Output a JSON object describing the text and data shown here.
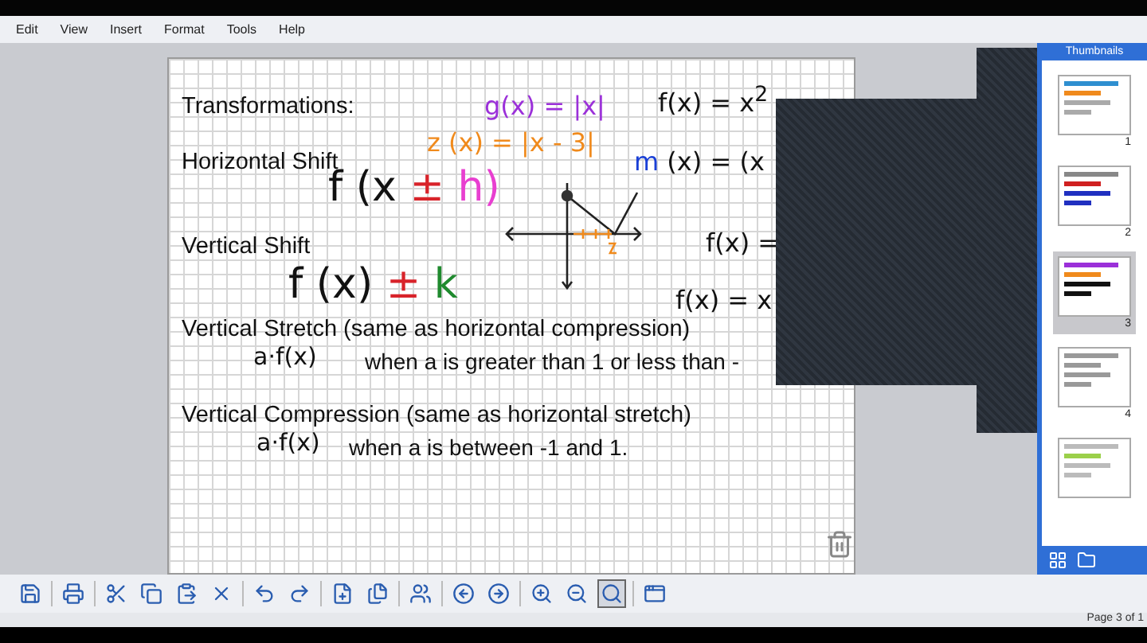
{
  "menu": [
    "Edit",
    "View",
    "Insert",
    "Format",
    "Tools",
    "Help"
  ],
  "canvas": {
    "texts": [
      {
        "kind": "heading",
        "text": "Transformations:"
      },
      {
        "kind": "heading",
        "text": "Horizontal Shift"
      },
      {
        "kind": "heading",
        "text": "Vertical Shift"
      },
      {
        "kind": "heading",
        "text": "Vertical Stretch (same as horizontal compression)"
      },
      {
        "kind": "note",
        "text": "when a is greater than 1 or less than -"
      },
      {
        "kind": "heading",
        "text": "Vertical Compression (same as horizontal stretch)"
      },
      {
        "kind": "note",
        "text": "when a is between -1 and 1."
      }
    ],
    "formulas": [
      {
        "parts": [
          {
            "text": "f (x ",
            "color": "#111111"
          },
          {
            "text": "±",
            "color": "#d8232a"
          },
          {
            "text": " h)",
            "color": "#e83fd0"
          }
        ]
      },
      {
        "parts": [
          {
            "text": "f (x) ",
            "color": "#111111"
          },
          {
            "text": "±",
            "color": "#d8232a"
          },
          {
            "text": " k",
            "color": "#1f8a2e"
          }
        ]
      },
      {
        "parts": [
          {
            "text": "a·f(x)",
            "color": "#111111"
          }
        ]
      },
      {
        "parts": [
          {
            "text": "a·f(x)",
            "color": "#111111"
          }
        ]
      },
      {
        "parts": [
          {
            "text": "g(x) = |x|",
            "color": "#9b30d9"
          }
        ]
      },
      {
        "parts": [
          {
            "text": "z (x) = |x - 3|",
            "color": "#f08a1c"
          }
        ]
      },
      {
        "parts": [
          {
            "text": "f(x) = x$^{2}$",
            "color": "#111111"
          }
        ]
      },
      {
        "parts": [
          {
            "text": "m",
            "color": "#1a3fd6"
          },
          {
            "text": " (x) = (x",
            "color": "#111111"
          }
        ]
      },
      {
        "parts": [
          {
            "text": "f(x) =",
            "color": "#111111"
          }
        ]
      },
      {
        "parts": [
          {
            "text": "f(x) = x",
            "color": "#111111"
          }
        ]
      }
    ]
  },
  "sidebar": {
    "title": "Thumbnails",
    "thumbnails": [
      {
        "label": "1",
        "selected": false
      },
      {
        "label": "2",
        "selected": false
      },
      {
        "label": "3",
        "selected": true
      },
      {
        "label": "4",
        "selected": false
      },
      {
        "selected": false
      }
    ]
  },
  "toolbar": [
    {
      "kind": "save",
      "selected": false
    },
    {
      "kind": "print",
      "selected": false
    },
    {
      "kind": "cut",
      "selected": false
    },
    {
      "kind": "copy",
      "selected": false
    },
    {
      "kind": "paste",
      "selected": false
    },
    {
      "kind": "delete",
      "selected": false
    },
    {
      "kind": "undo",
      "selected": false
    },
    {
      "kind": "redo",
      "selected": false
    },
    {
      "kind": "add-page",
      "selected": false
    },
    {
      "kind": "clone-page",
      "selected": false
    },
    {
      "kind": "users",
      "selected": false
    },
    {
      "kind": "back",
      "selected": false
    },
    {
      "kind": "forward",
      "selected": false
    },
    {
      "kind": "zoom-in",
      "selected": false
    },
    {
      "kind": "zoom-out",
      "selected": false
    },
    {
      "kind": "zoom-fit",
      "selected": true
    },
    {
      "kind": "window",
      "selected": false
    }
  ],
  "status": "Page 3 of 1"
}
